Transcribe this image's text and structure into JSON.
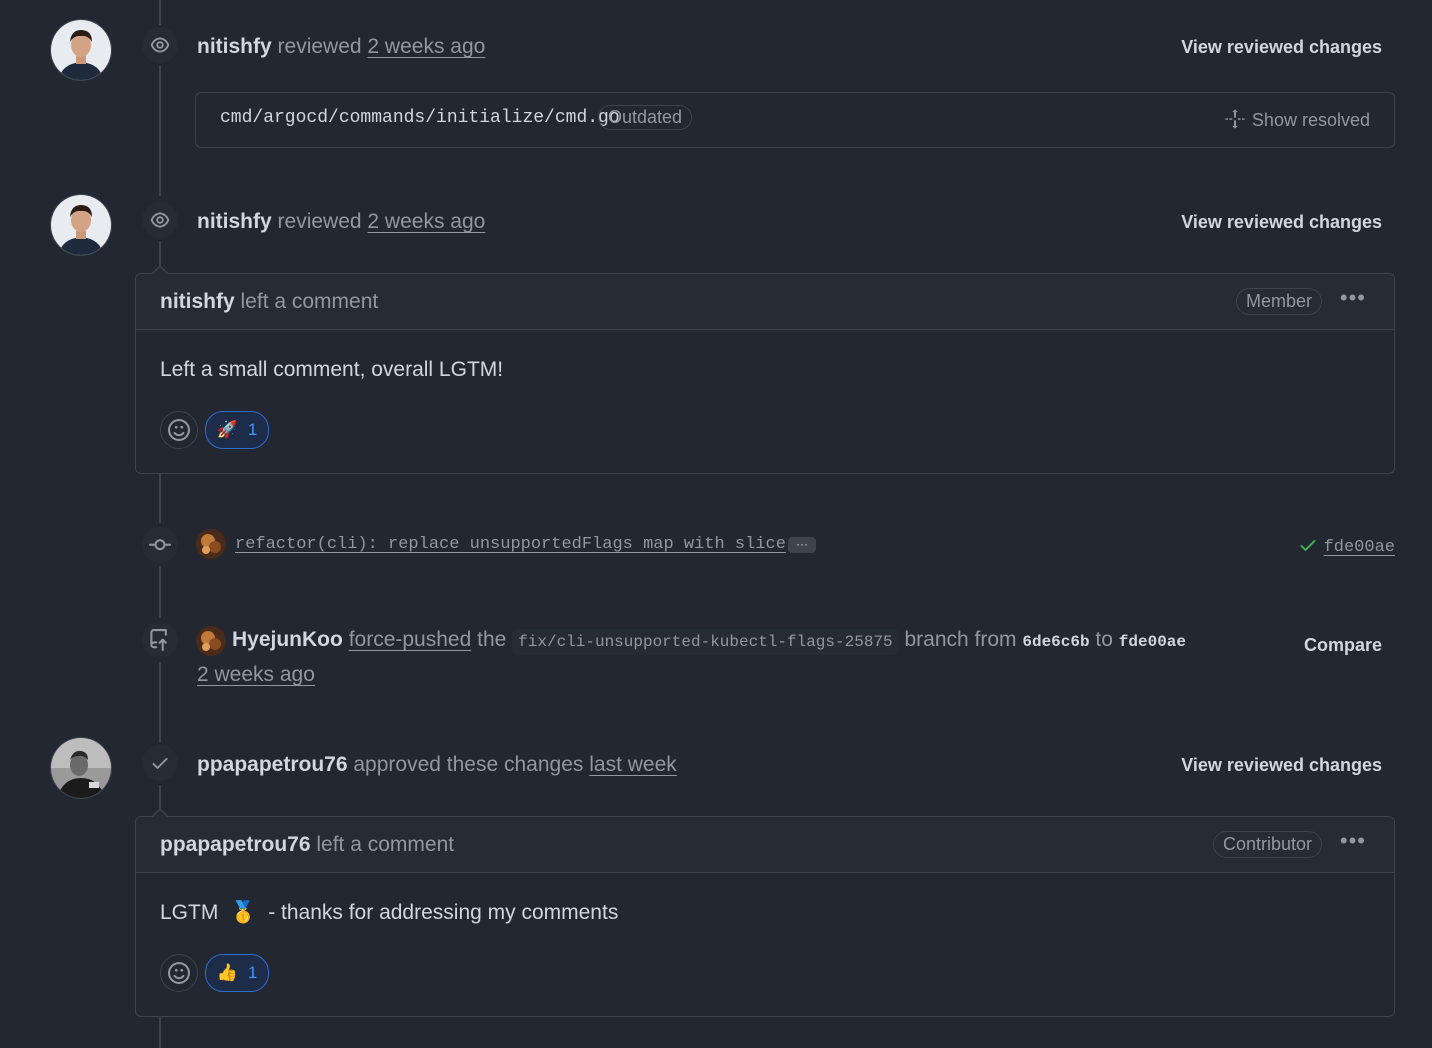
{
  "review1": {
    "user": "nitishfy",
    "action": "reviewed",
    "time": "2 weeks ago",
    "view_link": "View reviewed changes",
    "file_path": "cmd/argocd/commands/initialize/cmd.go",
    "outdated_label": "Outdated",
    "show_resolved": "Show resolved"
  },
  "review2": {
    "user": "nitishfy",
    "action": "reviewed",
    "time": "2 weeks ago",
    "view_link": "View reviewed changes",
    "comment": {
      "author": "nitishfy",
      "action": "left a comment",
      "role": "Member",
      "body": "Left a small comment, overall LGTM!",
      "reaction_emoji": "🚀",
      "reaction_count": "1"
    }
  },
  "commit": {
    "message": "refactor(cli): replace unsupportedFlags map with slice",
    "ellipsis": "···",
    "sha": "fde00ae"
  },
  "force_push": {
    "user": "HyejunKoo",
    "action": "force-pushed",
    "the": "the",
    "branch": "fix/cli-unsupported-kubectl-flags-25875",
    "branch_from": "branch from",
    "from_sha": "6de6c6b",
    "to": "to",
    "to_sha": "fde00ae",
    "time": "2 weeks ago",
    "compare_link": "Compare"
  },
  "approval": {
    "user": "ppapapetrou76",
    "action": "approved these changes",
    "time": "last week",
    "view_link": "View reviewed changes",
    "comment": {
      "author": "ppapapetrou76",
      "action": "left a comment",
      "role": "Contributor",
      "body_prefix": "LGTM",
      "body_emoji": "🥇",
      "body_suffix": "- thanks for addressing my comments",
      "reaction_emoji": "👍",
      "reaction_count": "1"
    }
  },
  "colors": {
    "background": "#222731",
    "border": "#3d444d",
    "accent_blue": "#4493f8",
    "success_green": "#3fb950",
    "muted": "#9198a1"
  }
}
